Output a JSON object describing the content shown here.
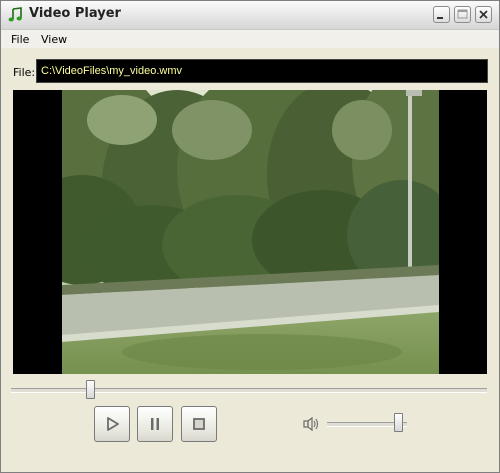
{
  "window": {
    "title": "Video Player",
    "icon": "music-note-icon"
  },
  "titlebar_buttons": [
    "minimize-icon",
    "maximize-icon",
    "close-icon"
  ],
  "menu": [
    {
      "label": "File"
    },
    {
      "label": "View"
    }
  ],
  "file": {
    "label": "File:",
    "path": "C:\\VideoFiles\\my_video.wmv"
  },
  "video": {
    "content": "park-scene-with-trees-and-road"
  },
  "playback": {
    "position_fraction": 0.16
  },
  "controls": {
    "play_icon": "play-icon",
    "pause_icon": "pause-icon",
    "stop_icon": "stop-icon"
  },
  "volume": {
    "icon": "speaker-icon",
    "level_fraction": 0.95
  },
  "colors": {
    "file_text": "#ffff99",
    "file_background": "#000000",
    "button_icon": "#6b6b6b"
  }
}
